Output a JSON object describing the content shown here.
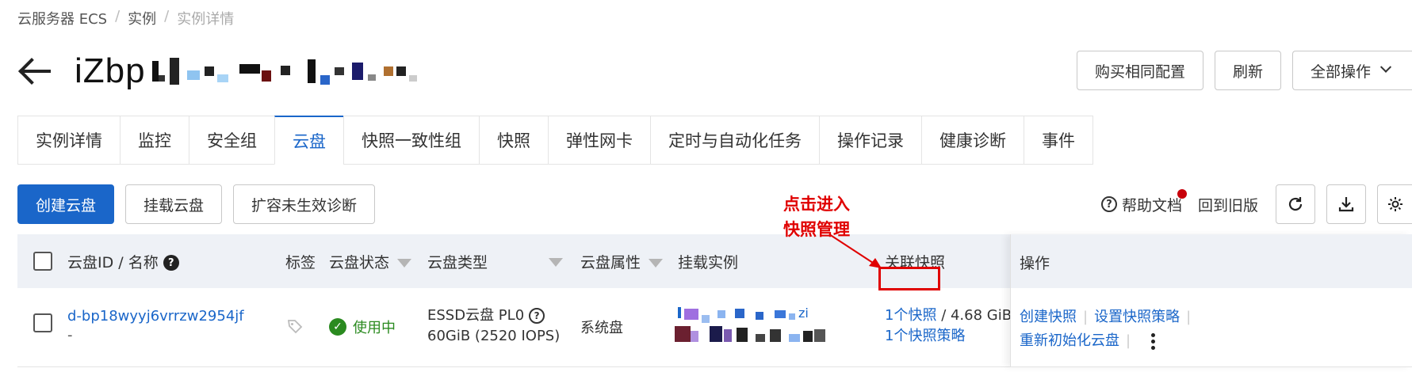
{
  "breadcrumb": {
    "item1": "云服务器 ECS",
    "item2": "实例",
    "item3": "实例详情",
    "sep": "/"
  },
  "instance": {
    "title_prefix": "iZbp"
  },
  "top_actions": {
    "buy_same": "购买相同配置",
    "refresh": "刷新",
    "all_ops": "全部操作"
  },
  "tabs": [
    "实例详情",
    "监控",
    "安全组",
    "云盘",
    "快照一致性组",
    "快照",
    "弹性网卡",
    "定时与自动化任务",
    "操作记录",
    "健康诊断",
    "事件"
  ],
  "active_tab": "云盘",
  "toolbar": {
    "create_disk": "创建云盘",
    "attach_disk": "挂载云盘",
    "resize_diag": "扩容未生效诊断"
  },
  "right_tools": {
    "help_doc": "帮助文档",
    "old_version": "回到旧版"
  },
  "table": {
    "headers": {
      "disk_id": "云盘ID / 名称",
      "tags": "标签",
      "status": "云盘状态",
      "type": "云盘类型",
      "attr": "云盘属性",
      "instance": "挂载实例",
      "snapshot": "关联快照",
      "ops": "操作"
    },
    "row": {
      "disk_id": "d-bp18wyyj6vrrzw2954jf",
      "disk_name": "-",
      "status": "使用中",
      "type_line1": "ESSD云盘 PL0",
      "type_line2": "60GiB (2520 IOPS)",
      "attr": "系统盘",
      "instance_suffix": "zi",
      "snapshot_link": "1个快照",
      "snapshot_size": "/ 4.68 GiB",
      "snapshot_policy": "1个快照策略",
      "op_create_snapshot": "创建快照",
      "op_set_policy": "设置快照策略",
      "op_reinit": "重新初始化云盘"
    }
  },
  "annotation": {
    "line1": "点击进入",
    "line2": "快照管理"
  },
  "colors": {
    "accent": "#1a66c9",
    "annotation_red": "#e00000",
    "status_green": "#2a8a1f"
  }
}
